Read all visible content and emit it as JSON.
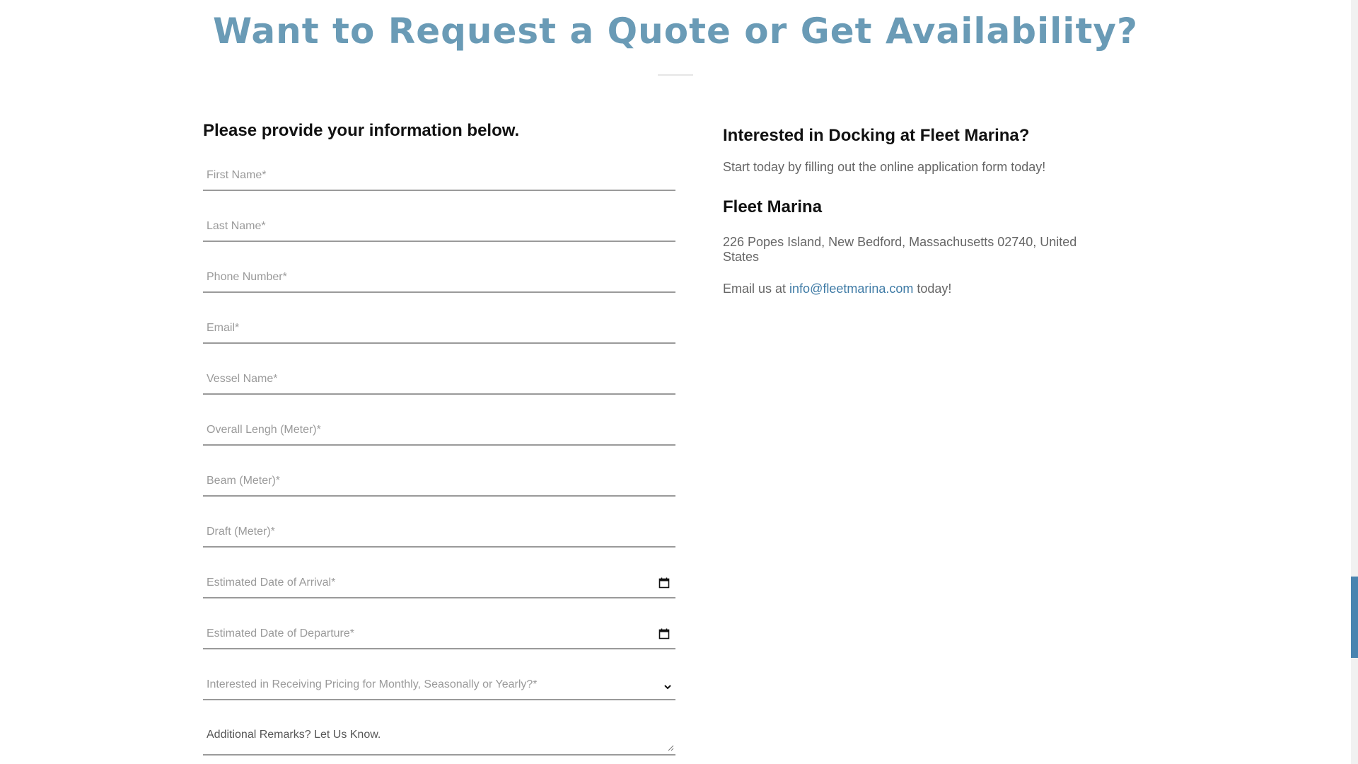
{
  "colors": {
    "accent": "#6a9bb6",
    "link": "#3e7aa5",
    "scrollbar_thumb": "#4a84b0"
  },
  "headline": "Want to Request a Quote or Get Availability?",
  "form": {
    "heading": "Please provide your information below.",
    "fields": [
      {
        "placeholder": "First Name*",
        "icon": ""
      },
      {
        "placeholder": "Last Name*",
        "icon": ""
      },
      {
        "placeholder": "Phone Number*",
        "icon": ""
      },
      {
        "placeholder": "Email*",
        "icon": ""
      },
      {
        "placeholder": "Vessel Name*",
        "icon": ""
      },
      {
        "placeholder": "Overall Lengh (Meter)*",
        "icon": ""
      },
      {
        "placeholder": "Beam (Meter)*",
        "icon": ""
      },
      {
        "placeholder": "Draft (Meter)*",
        "icon": ""
      },
      {
        "placeholder": "Estimated Date of Arrival*",
        "icon": "calendar-icon"
      },
      {
        "placeholder": "Estimated Date of Departure*",
        "icon": "calendar-icon"
      },
      {
        "placeholder": "Interested in Receiving Pricing for Monthly, Seasonally or Yearly?*",
        "icon": "chevron-down-icon"
      }
    ],
    "remarks_placeholder": "Additional Remarks? Let Us Know."
  },
  "info": {
    "title": "Interested in Docking at Fleet Marina?",
    "cta": "Start today by filling out the online application form today!",
    "marina_name": "Fleet Marina",
    "address": "226 Popes Island, New Bedford, Massachusetts 02740, United States",
    "email_prefix": "Email us at ",
    "email": "info@fleetmarina.com",
    "email_suffix": " today!"
  }
}
